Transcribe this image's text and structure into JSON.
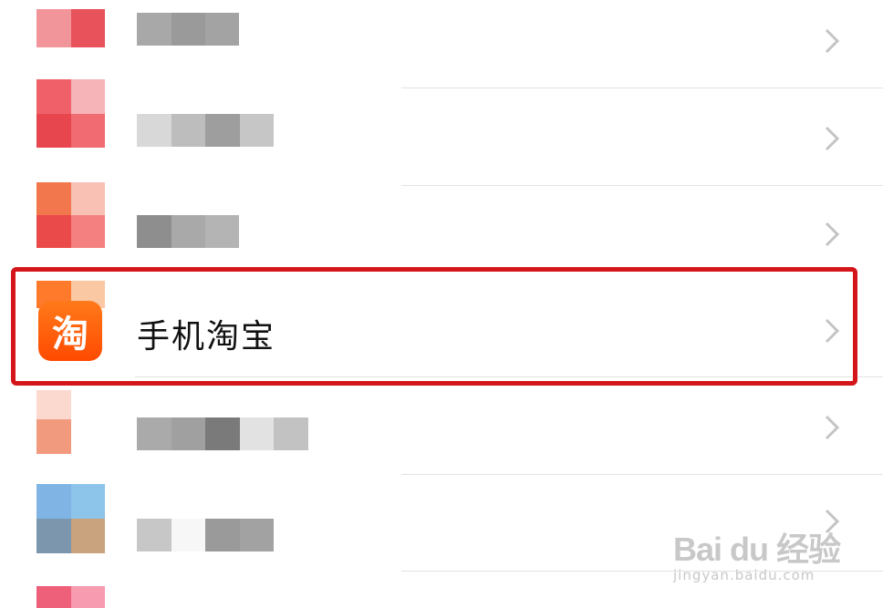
{
  "app_list": {
    "highlighted_item": {
      "label": "手机淘宝",
      "icon_char": "淘",
      "icon_name": "taobao-app-icon"
    },
    "chevron_icon": "chevron-right-icon"
  },
  "highlight_color": "#d4161b",
  "watermark": {
    "brand": "Bai du 经验",
    "url": "jingyan.baidu.com"
  }
}
